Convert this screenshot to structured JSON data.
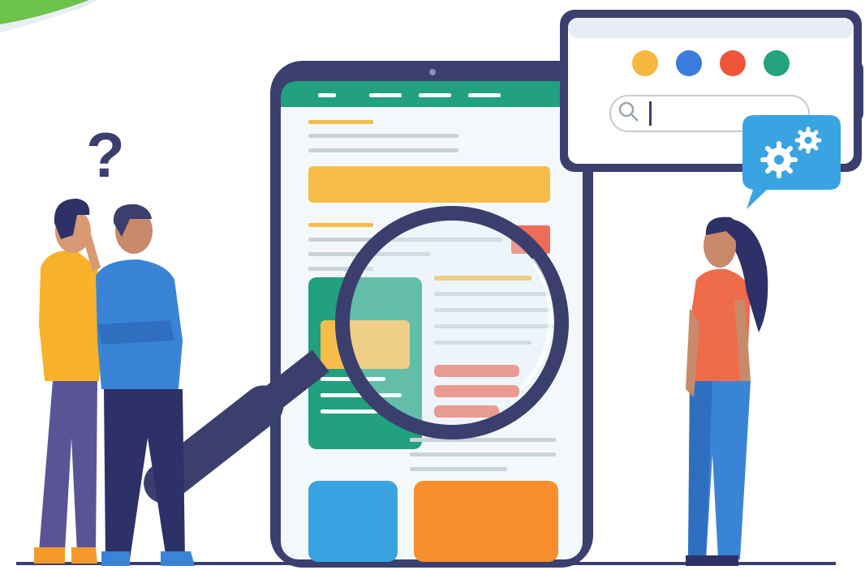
{
  "illustration": {
    "question_mark": "?",
    "browser_dots": [
      "#f8b73f",
      "#3b7ddd",
      "#f0553a",
      "#22a37b"
    ],
    "search_value": "",
    "colors": {
      "navy": "#3a3f6e",
      "teal": "#21a17f",
      "yellow": "#f8bc4a",
      "orange": "#f78f2e",
      "red": "#ee6c5a",
      "blue": "#3aa4e3",
      "green_corner": "#6cc24a"
    }
  }
}
